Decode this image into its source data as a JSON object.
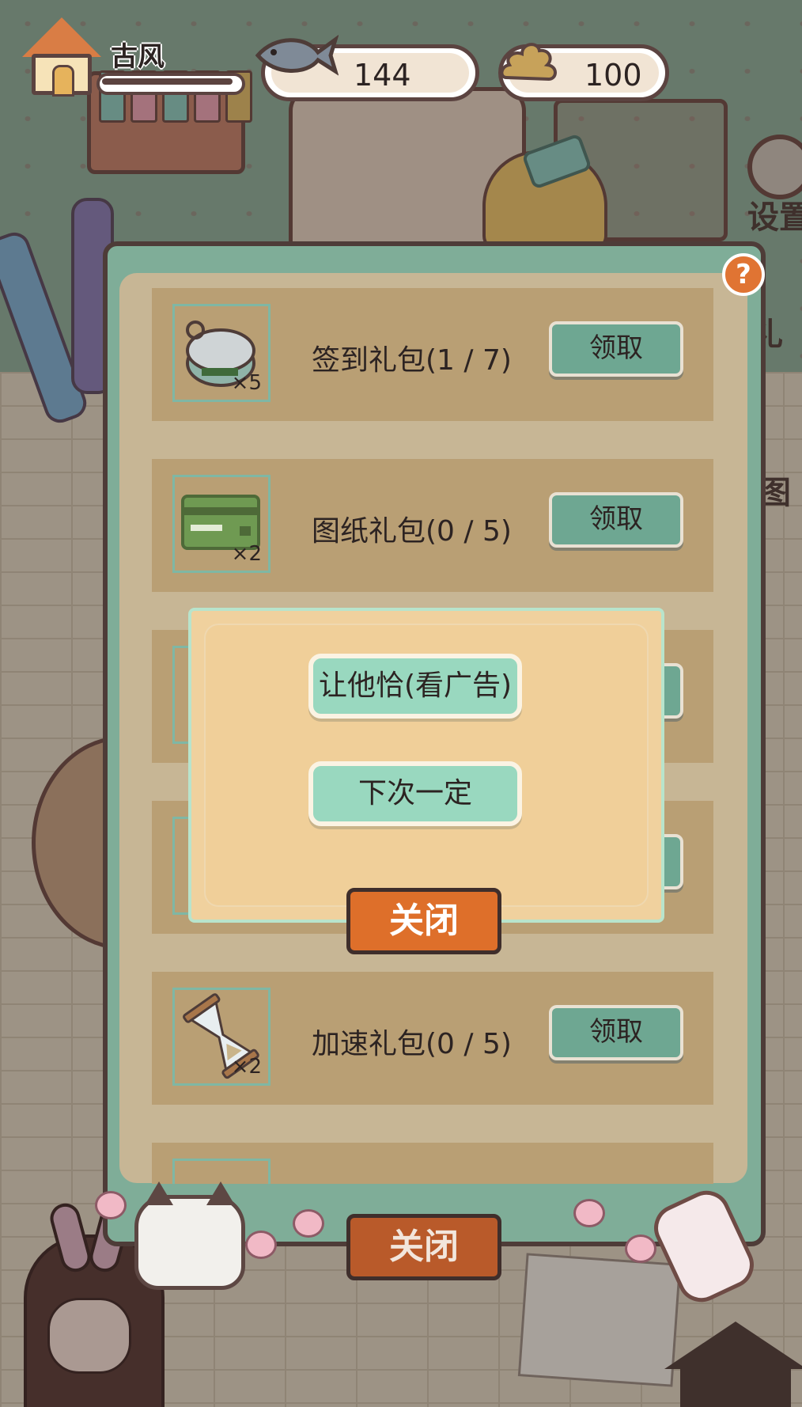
{
  "hud": {
    "player_name": "古风",
    "fish_count": "144",
    "poop_count": "100",
    "xp_progress": 0.95
  },
  "side_buttons": {
    "settings_label": "设置",
    "gift_label_partial": "礼",
    "drawing_label_partial": "图"
  },
  "gift_panel": {
    "rows": [
      {
        "title": "签到礼包(1 / 7)",
        "qty": "×5",
        "button": "领取",
        "icon": "tuna-can-icon"
      },
      {
        "title": "图纸礼包(0 / 5)",
        "qty": "×2",
        "button": "领取",
        "icon": "blueprint-card-icon"
      },
      {
        "title": "",
        "qty": "",
        "button": "",
        "icon": "hidden-item-icon"
      },
      {
        "title": "",
        "qty": "",
        "button": "",
        "icon": "hidden-item-icon"
      },
      {
        "title": "加速礼包(0 / 5)",
        "qty": "×2",
        "button": "领取",
        "icon": "hourglass-icon"
      }
    ],
    "close_label": "关闭",
    "help_label": "?"
  },
  "ad_modal": {
    "watch_ad_label": "让他恰(看广告)",
    "next_time_label": "下次一定",
    "close_label": "关闭"
  },
  "colors": {
    "panel_green": "#7fad98",
    "row_tan": "#b99f74",
    "claim_button": "#6ea792",
    "modal_button": "#99d8bf",
    "close_orange": "#de6f2a",
    "outline_brown": "#4e3c38"
  }
}
